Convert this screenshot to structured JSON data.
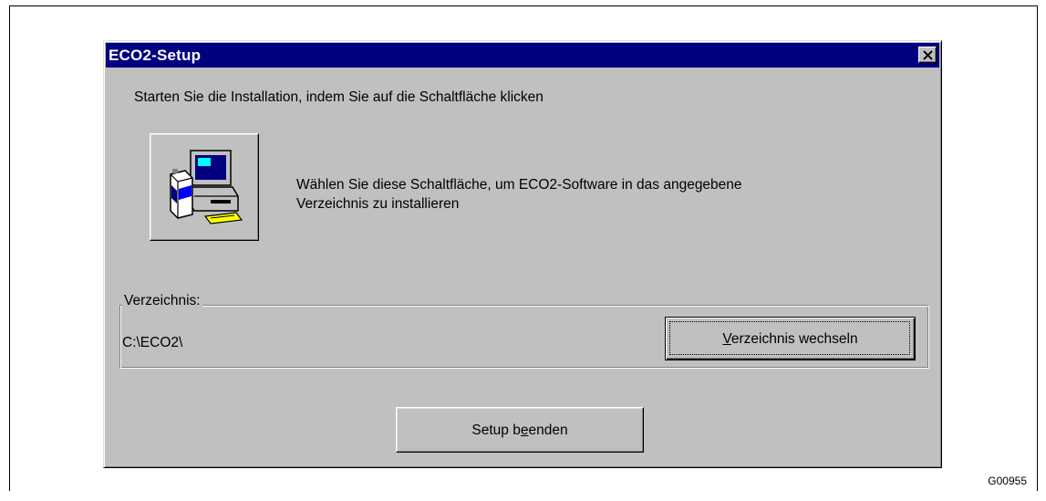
{
  "figure_id": "G00955",
  "dialog": {
    "title": "ECO2-Setup",
    "close_label": "×",
    "intro_text": "Starten Sie die Installation, indem Sie auf die Schaltfläche klicken",
    "install_description_line1": "Wählen Sie diese Schaltfläche, um ECO2-Software in das angegebene",
    "install_description_line2": "Verzeichnis zu installieren",
    "directory_group_label": "Verzeichnis:",
    "directory_value": "C:\\ECO2\\",
    "change_directory_button": {
      "mnemonic": "V",
      "rest": "erzeichnis wechseln"
    },
    "exit_button": {
      "before": "Setup b",
      "mnemonic": "e",
      "after": "enden"
    }
  },
  "icons": {
    "install": "computer-setup-icon",
    "close": "close-icon"
  },
  "colors": {
    "titlebar": "#000080",
    "dialog_face": "#c0c0c0"
  }
}
